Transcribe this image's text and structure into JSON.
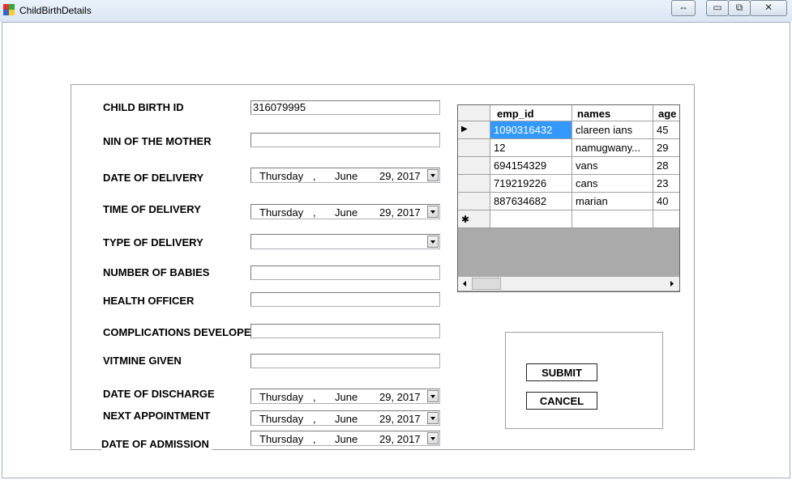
{
  "window": {
    "title": "ChildBirthDetails",
    "controls": [
      "⇔",
      "▭",
      "⧉",
      "✕"
    ]
  },
  "form": {
    "labels": {
      "child_birth_id": "CHILD BIRTH ID",
      "nin_mother": "NIN OF THE MOTHER",
      "date_delivery": "DATE OF DELIVERY",
      "time_delivery": "TIME OF DELIVERY",
      "type_delivery": "TYPE OF DELIVERY",
      "number_babies": "NUMBER OF BABIES",
      "health_officer": "HEALTH OFFICER",
      "complications": "COMPLICATIONS DEVELOPE",
      "vitamine": "VITMINE GIVEN",
      "date_discharge": "DATE OF DISCHARGE",
      "next_appointment": "NEXT APPOINTMENT",
      "date_admission": "DATE OF ADMISSION"
    },
    "values": {
      "child_birth_id": "316079995",
      "nin_mother": "",
      "type_delivery": "",
      "number_babies": "",
      "health_officer": "",
      "complications": "",
      "vitamine": ""
    },
    "date": {
      "day": "Thursday",
      "sep": ",",
      "month": "June",
      "date": "29, 2017"
    }
  },
  "grid": {
    "columns": [
      "emp_id",
      "names",
      "age"
    ],
    "rows": [
      [
        "1090316432",
        "clareen ians",
        "45"
      ],
      [
        "12",
        "namugwany...",
        "29"
      ],
      [
        "694154329",
        "vans",
        "28"
      ],
      [
        "719219226",
        "cans",
        "23"
      ],
      [
        "887634682",
        "marian",
        "40"
      ]
    ],
    "new_row_marker": "✱",
    "current_row_marker": "▶"
  },
  "buttons": {
    "submit": "SUBMIT",
    "cancel": "CANCEL"
  }
}
